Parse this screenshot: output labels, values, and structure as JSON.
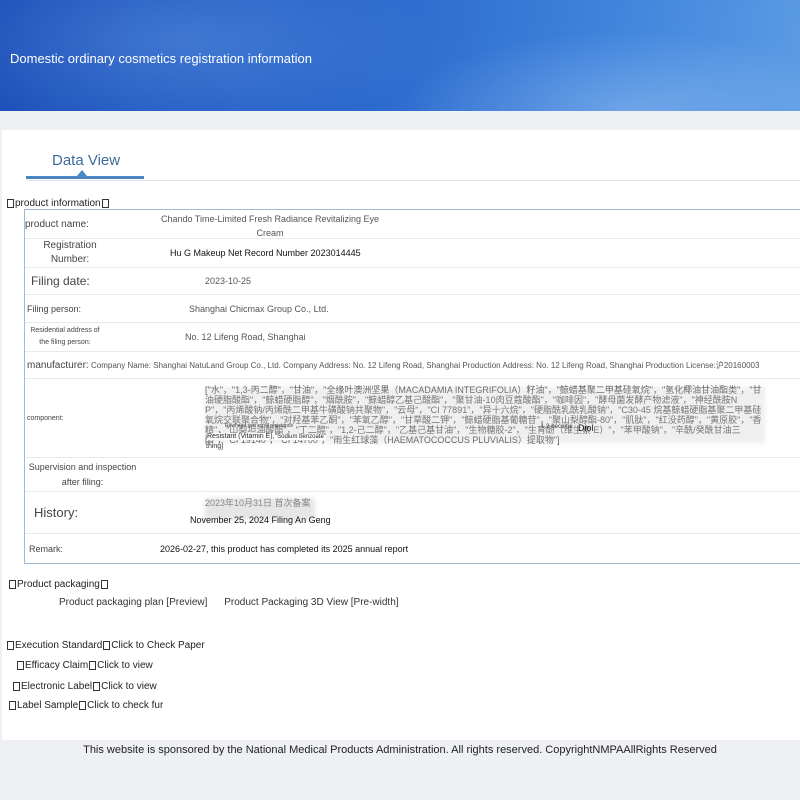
{
  "header": {
    "title": "Domestic ordinary cosmetics registration information"
  },
  "tab": {
    "label": "Data View"
  },
  "product_information": {
    "section_title": "product information",
    "rows": {
      "product_name_label": "product name:",
      "product_name_value_line1": "Chando Time-Limited Fresh Radiance Revitalizing Eye",
      "product_name_value_line2": "Cream",
      "reg_label_line1": "Registration",
      "reg_label_line2": "Number:",
      "reg_value": "Hu G Makeup Net Record Number 2023014445",
      "filing_date_label": "Filing date:",
      "filing_date_value": "2023-10-25",
      "filing_person_label": "Filing person:",
      "filing_person_value": "Shanghai Chicmax Group Co., Ltd.",
      "address_label_line1": "Residential address of",
      "address_label_line2": "the filing person:",
      "address_value": "No. 12 Lifeng Road, Shanghai",
      "manufacturer_label": "manufacturer:",
      "manufacturer_value": "Company Name: Shanghai NatuLand Group Co., Ltd. Company Address: No. 12 Lifeng Road, Shanghai Production Address: No. 12 Lifeng Road, Shanghai Production License:沪20160003",
      "component_label": "component:",
      "component_value": "[\"水\"，\"1,3-丙二醇\"，\"甘油\"，\"全缘叶澳洲坚果（MACADAMIA INTEGRIFOLIA）籽油\"，\"鲸蜡基聚二甲基硅氧烷\"，\"氢化椰油甘油酯类\"，\"甘油硬脂酸酯\"，\"鲸蜡硬脂醇\"，\"烟酰胺\"，\"鲸蜡醇乙基己酸酯\"，\"聚甘油-10肉豆蔻酸酯\"，\"咖啡因\"，\"酵母菌发酵产物滤液\"，\"神经酰胺NP\"，\"丙烯酸钠/丙烯酰二甲基牛磺酸钠共聚物\"，\"云母\"，\"CI 77891\"，\"异十六烷\"，\"硬脂酰乳酰乳酸钠\"，\"C30-45 烷基鲸蜡硬脂基聚二甲基硅氧烷交联聚合物\"，\"对羟基苯乙酮\"，\"苯氧乙醇\"，\"甘草酸二钾\"，\"鲸蜡硬脂基葡糖苷\"，\"聚山梨醇酯-80\"，\"肌肽\"，\"红没药醇\"，\"黄原胶\"，\"香精\"，\"山梨坦油酸酯\"，\"丁二醇\"，\"1,2-己二醇\"，\"乙基己基甘油\"，\"生物糖胶-2\"，\"生育酚（维生素 E）\"，\"苯甲酸钠\"，\"辛酰/癸酰甘油三酯\"，\"CI 19140\"，\"CI 14700\"，\"雨生红球藻（HAEMATOCOCCUS PLUVIALIS）提取物\"]",
      "component_overlay_1": "Rawhead sort scroll resistance",
      "component_overlay_2": "1,2-become",
      "component_overlay_3": "Diol",
      "component_overlay_4": "Resistant (Vitamin E),",
      "component_overlay_5": "\"Sodium benzoate\"",
      "component_overlay_6": "thing]",
      "supervision_label_line1": "Supervision and inspection",
      "supervision_label_line2": "after filing:",
      "history_label": "History:",
      "history_value_1": "2023年10月31日 首次备案",
      "history_value_2": "November 25, 2024 Filing An Geng",
      "remark_label": "Remark:",
      "remark_value": "2026-02-27, this product has completed its 2025 annual report"
    }
  },
  "product_packaging": {
    "section_title": "Product packaging",
    "plan_link": "Product packaging plan [Preview]",
    "view3d_link": "Product Packaging 3D View [Pre-width]"
  },
  "links": [
    {
      "label": "Execution Standard",
      "action": "Click to Check Paper"
    },
    {
      "label": "Efficacy Claim",
      "action": "Click to view"
    },
    {
      "label": "Electronic Label",
      "action": "Click to view"
    },
    {
      "label": "Label Sample",
      "action": "Click to check fur"
    }
  ],
  "footer": {
    "text": "This website is sponsored by the National Medical Products Administration. All rights reserved. CopyrightNMPAAllRights Reserved"
  }
}
